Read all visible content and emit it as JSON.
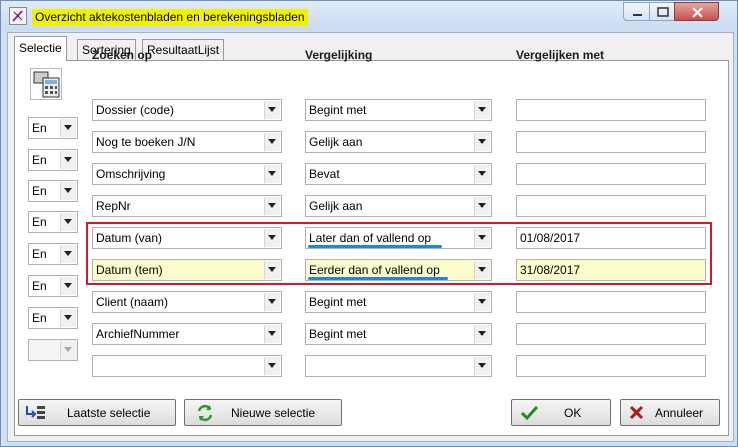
{
  "window": {
    "title": "Overzicht aktekostenbladen en berekeningsbladen"
  },
  "tabs": [
    {
      "label": "Selectie"
    },
    {
      "label": "Sortering"
    },
    {
      "label": "ResultaatLijst"
    }
  ],
  "headers": {
    "search_on": "Zoeken op",
    "comparison": "Vergelijking",
    "compare_with": "Vergelijken met"
  },
  "rows": [
    {
      "logic": "",
      "field": "Dossier (code)",
      "comparison": "Begint met",
      "value": ""
    },
    {
      "logic": "En",
      "field": "Nog te boeken J/N",
      "comparison": "Gelijk aan",
      "value": ""
    },
    {
      "logic": "En",
      "field": "Omschrijving",
      "comparison": "Bevat",
      "value": ""
    },
    {
      "logic": "En",
      "field": "RepNr",
      "comparison": "Gelijk aan",
      "value": ""
    },
    {
      "logic": "En",
      "field": "Datum (van)",
      "comparison": "Later dan of vallend op",
      "value": "01/08/2017"
    },
    {
      "logic": "En",
      "field": "Datum (tem)",
      "comparison": "Eerder dan of vallend op",
      "value": "31/08/2017"
    },
    {
      "logic": "En",
      "field": "Client (naam)",
      "comparison": "Begint met",
      "value": ""
    },
    {
      "logic": "En",
      "field": "ArchiefNummer",
      "comparison": "Begint met",
      "value": ""
    },
    {
      "logic": "",
      "field": "",
      "comparison": "",
      "value": ""
    }
  ],
  "buttons": {
    "last_selection": "Laatste selectie",
    "new_selection": "Nieuwe selectie",
    "ok": "OK",
    "cancel": "Annuleer"
  },
  "colors": {
    "title_highlight": "#f2f200",
    "row_highlight": "#fdfccc",
    "annotation_box": "#d11a2a",
    "annotation_underline": "#1e8ad6"
  }
}
